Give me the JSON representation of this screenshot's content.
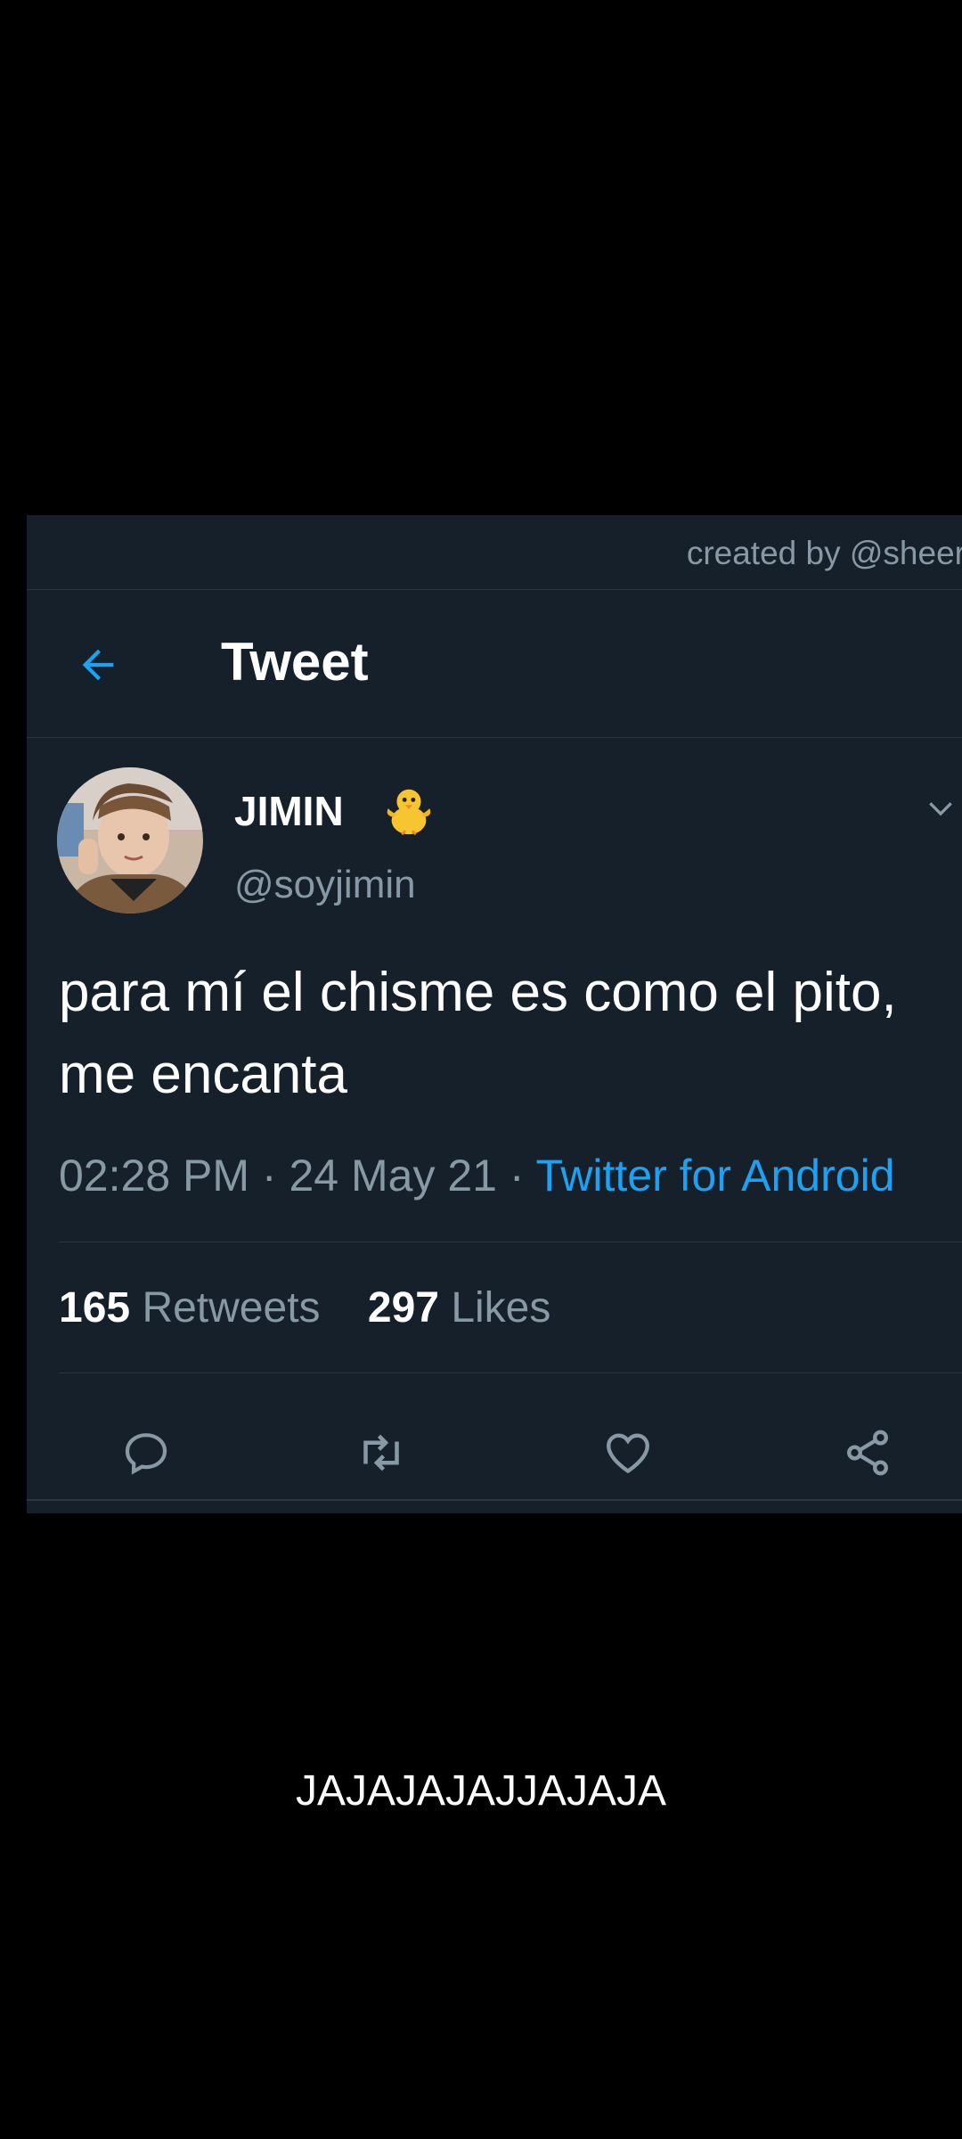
{
  "watermark": "created by @sheer",
  "header": {
    "back_icon": "arrow-left-icon",
    "title": "Tweet"
  },
  "tweet": {
    "author": {
      "display_name": "JIMIN",
      "badge_icon": "chick-icon",
      "handle": "@soyjimin",
      "avatar_icon": "avatar"
    },
    "menu_icon": "chevron-down-icon",
    "text": "para mí el chisme es como el pito, me encanta",
    "time": "02:28 PM",
    "separator": "·",
    "date": "24 May 21",
    "source": "Twitter for Android",
    "stats": {
      "retweets_count": "165",
      "retweets_label": "Retweets",
      "likes_count": "297",
      "likes_label": "Likes"
    },
    "actions": [
      {
        "icon": "reply-icon"
      },
      {
        "icon": "retweet-icon"
      },
      {
        "icon": "heart-icon"
      },
      {
        "icon": "share-icon"
      }
    ]
  },
  "caption": "JAJAJAJAJJAJAJA",
  "colors": {
    "card_background": "#15202b",
    "accent": "#1da1f2",
    "secondary_text": "#8899a6",
    "divider": "#2c3640"
  }
}
